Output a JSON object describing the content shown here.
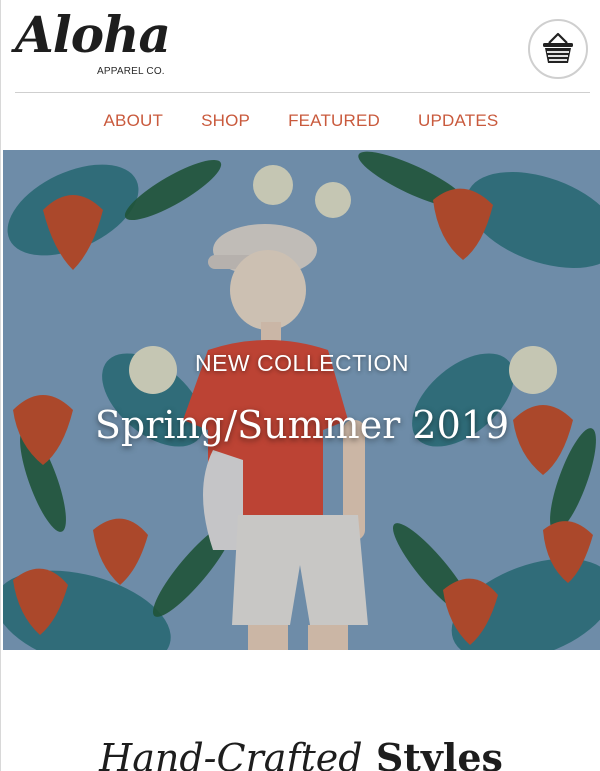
{
  "brand": {
    "logo_script": "Aloha",
    "logo_sub": "APPAREL CO."
  },
  "header": {
    "cart_icon": "shopping-basket-icon"
  },
  "nav": {
    "items": [
      {
        "label": "ABOUT"
      },
      {
        "label": "SHOP"
      },
      {
        "label": "FEATURED"
      },
      {
        "label": "UPDATES"
      }
    ]
  },
  "hero": {
    "kicker": "NEW COLLECTION",
    "title": "Spring/Summer 2019"
  },
  "section": {
    "heading_italic": "Hand-Crafted",
    "heading_bold": "Styles"
  },
  "colors": {
    "nav_text": "#c95a3d",
    "hero_bg": "#7b9fbd",
    "logo": "#1e1e1e"
  }
}
